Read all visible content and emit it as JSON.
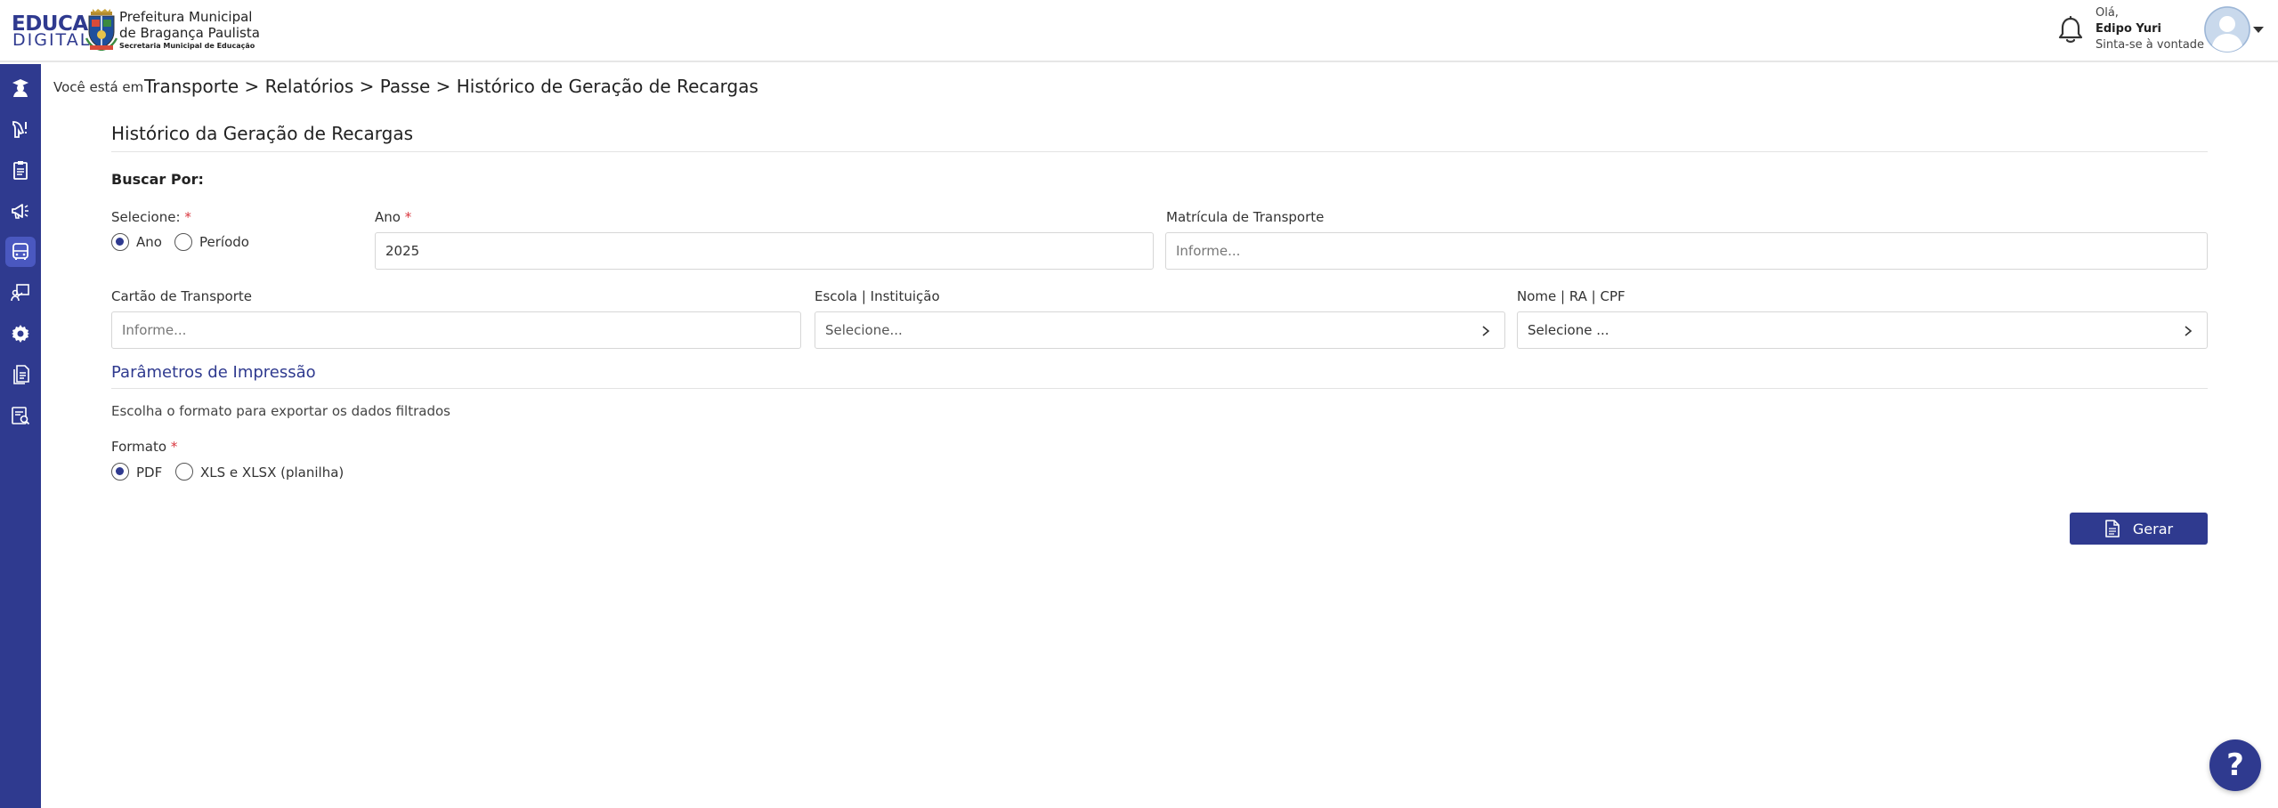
{
  "header": {
    "logo_top": "EDUCA",
    "logo_bottom": "DIGITAL",
    "prefeitura_line1": "Prefeitura Municipal",
    "prefeitura_line2": "de Bragança Paulista",
    "prefeitura_line3": "Secretaria Municipal de Educação",
    "greeting": "Olá,",
    "user_name": "Edipo Yuri",
    "greeting_sub": "Sinta-se à vontade"
  },
  "sidebar": {
    "items": [
      {
        "icon": "graduate-icon",
        "active": false
      },
      {
        "icon": "hand-alert-icon",
        "active": false
      },
      {
        "icon": "clipboard-icon",
        "active": false
      },
      {
        "icon": "megaphone-icon",
        "active": false
      },
      {
        "icon": "bus-icon",
        "active": true
      },
      {
        "icon": "teacher-board-icon",
        "active": false
      },
      {
        "icon": "gear-icon",
        "active": false
      },
      {
        "icon": "documents-icon",
        "active": false
      },
      {
        "icon": "report-search-icon",
        "active": false
      }
    ]
  },
  "breadcrumb": {
    "prefix": "Você está em",
    "path": "Transporte > Relatórios > Passe > Histórico de Geração de Recargas"
  },
  "main": {
    "title": "Histórico da Geração de Recargas",
    "search_heading": "Buscar Por:",
    "selecione_label": "Selecione:",
    "radio_ano": "Ano",
    "radio_periodo": "Período",
    "ano_label": "Ano",
    "ano_value": "2025",
    "matricula_label": "Matrícula de Transporte",
    "matricula_placeholder": "Informe...",
    "cartao_label": "Cartão de Transporte",
    "cartao_placeholder": "Informe...",
    "escola_label": "Escola | Instituição",
    "escola_placeholder": "Selecione...",
    "nome_label": "Nome | RA | CPF",
    "nome_placeholder": "Selecione ...",
    "required_mark": "*"
  },
  "print_params": {
    "title": "Parâmetros de Impressão",
    "description": "Escolha o formato para exportar os dados filtrados",
    "format_label": "Formato",
    "option_pdf": "PDF",
    "option_xls": "XLS e XLSX (planilha)",
    "selected": "PDF"
  },
  "actions": {
    "generate_label": "Gerar",
    "help_label": "?"
  },
  "colors": {
    "primary": "#2f3a8f",
    "sidebar_active": "#4a58c0",
    "required": "#d9363e"
  }
}
